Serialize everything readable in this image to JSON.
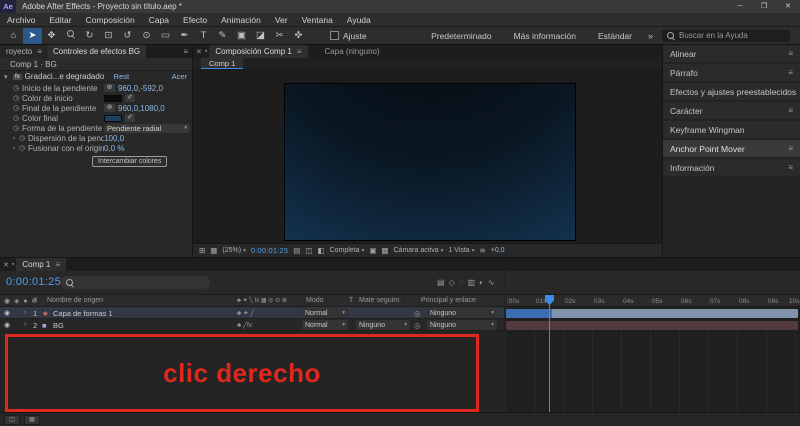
{
  "colors": {
    "accent_blue": "#3f8de2",
    "value_blue": "#8ab8e8",
    "timecode_blue": "#4f9fe8",
    "annotation_red": "#e0281e",
    "layer_bar_shape": "#8093aa",
    "layer_bar_shape_selected": "#3c6db0",
    "layer_bar_bg": "#523a3d",
    "ramp_start_color": "#0a0d12",
    "ramp_end_color": "#1d4060"
  },
  "icons": {
    "hamburger": "≡",
    "chevron_down": "▾",
    "close": "✕",
    "panel_dot": "▪",
    "stopwatch": "◷",
    "twirl_closed": "›",
    "point": "⊕",
    "eyedropper": "✐",
    "eye": "◉",
    "pickwhip": "◎",
    "expand": "⊞",
    "grid": "▦",
    "snapshot": "▤",
    "overlay": "◫",
    "channels": "◧",
    "roi": "▣",
    "checker": "▩",
    "fast_preview": "≋",
    "minimize": "─",
    "maximize": "❐",
    "overflow": "»"
  },
  "title_bar": {
    "app_logo": "Ae",
    "title": "Adobe After Effects - Proyecto sin título.aep *"
  },
  "menu_bar": {
    "items": [
      "Archivo",
      "Editar",
      "Composición",
      "Capa",
      "Efecto",
      "Animación",
      "Ver",
      "Ventana",
      "Ayuda"
    ]
  },
  "toolbar": {
    "tools": [
      {
        "name": "home",
        "glyph": "⌂"
      },
      {
        "name": "selection",
        "glyph": "➤"
      },
      {
        "name": "hand",
        "glyph": "✥"
      },
      {
        "name": "zoom",
        "glyph": "magnifier-css"
      },
      {
        "name": "orbit-camera",
        "glyph": "↻"
      },
      {
        "name": "unified-camera",
        "glyph": "⊡"
      },
      {
        "name": "rotation",
        "glyph": "↺"
      },
      {
        "name": "pan-behind",
        "glyph": "⊙"
      },
      {
        "name": "shape",
        "glyph": "▭"
      },
      {
        "name": "pen",
        "glyph": "✒"
      },
      {
        "name": "type",
        "glyph": "T"
      },
      {
        "name": "brush",
        "glyph": "✎"
      },
      {
        "name": "clone-stamp",
        "glyph": "▣"
      },
      {
        "name": "eraser",
        "glyph": "◪"
      },
      {
        "name": "roto-brush",
        "glyph": "✂"
      },
      {
        "name": "puppet",
        "glyph": "✜"
      }
    ],
    "snap_label": "Ajuste",
    "workspaces": [
      "Predeterminado",
      "Más información",
      "Estándar"
    ],
    "search_placeholder": "Buscar en la Ayuda"
  },
  "effect_controls": {
    "left_tab": "royecto",
    "active_tab": "Controles de efectos BG",
    "breadcrumb": "Comp 1 · BG",
    "effect": {
      "fx_badge": "fx",
      "name": "Gradaci...e degradado",
      "reset_label": "Rest",
      "about_label": "Acer"
    },
    "properties": [
      {
        "name": "Inicio de la pendiente",
        "value": "960,0,-592,0",
        "type": "point"
      },
      {
        "name": "Color de inicio",
        "type": "color",
        "swatch": "#0a0d12"
      },
      {
        "name": "Final de la pendiente",
        "value": "960,0,1080,0",
        "type": "point"
      },
      {
        "name": "Color final",
        "type": "color",
        "swatch": "#1d4060"
      },
      {
        "name": "Forma de la pendiente",
        "value": "Pendiente radial",
        "type": "dropdown"
      },
      {
        "name": "Dispersión de la pendie",
        "value": "100,0",
        "type": "slider"
      },
      {
        "name": "Fusionar con el original",
        "value": "0,0 %",
        "type": "slider"
      }
    ],
    "swap_colors_button": "Intercambiar colores"
  },
  "composition": {
    "tab": "Composición Comp 1",
    "inactive_tab": "Capa (ninguno)",
    "viewer_tab": "Comp 1",
    "footer": {
      "zoom": "(25%)",
      "timecode": "0:00:01:25",
      "resolution": "Completa",
      "camera": "Cámara activa",
      "view_layout": "1 Vista",
      "exposure": "+0,0"
    }
  },
  "right_panels": {
    "items": [
      {
        "label": "Alinear"
      },
      {
        "label": "Párrafo"
      },
      {
        "label": "Efectos y ajustes preestablecidos"
      },
      {
        "label": "Carácter"
      },
      {
        "label": "Keyframe Wingman"
      },
      {
        "label": "Anchor Point Mover",
        "active": true
      },
      {
        "label": "Información"
      }
    ]
  },
  "timeline": {
    "tab": "Comp 1",
    "timecode": "0:00:01:25",
    "toggle_icons": [
      {
        "name": "composition-mini-flowchart",
        "glyph": "▤"
      },
      {
        "name": "draft-3d",
        "glyph": "◇"
      },
      {
        "name": "shy-layers",
        "glyph": "◌"
      },
      {
        "name": "frame-blending",
        "glyph": "▥"
      },
      {
        "name": "motion-blur",
        "glyph": "◐"
      },
      {
        "name": "graph-editor",
        "glyph": "∿"
      }
    ],
    "columns": {
      "visibility_icons": "◉ ◈ ● ⊙",
      "index": "#",
      "source_name": "Nombre de origen",
      "switches_icons": "♣ ✦ ╲ fx ▦ ◎ ⊙ ⊕",
      "mode": "Modo",
      "t": "T",
      "track_matte": "Mate seguim.",
      "parent": "Principal y enlace"
    },
    "layers": [
      {
        "index": "1",
        "icon": "★",
        "icon_color": "#e06a6a",
        "name": "Capa de formas 1",
        "switches": "♣ ✦ ╱",
        "mode": "Normal",
        "parent": "Ninguno"
      },
      {
        "index": "2",
        "icon": "■",
        "icon_color": "#a2a2dc",
        "name": "BG",
        "switches": "♣ ╱fx",
        "mode": "Normal",
        "matte": "Ninguno",
        "parent": "Ninguno"
      }
    ],
    "ruler_labels": [
      ":00s",
      "01s",
      "02s",
      "03s",
      "04s",
      "05s",
      "06s",
      "07s",
      "08s",
      "09s",
      "10s"
    ]
  },
  "annotation": {
    "text": "clic derecho"
  }
}
